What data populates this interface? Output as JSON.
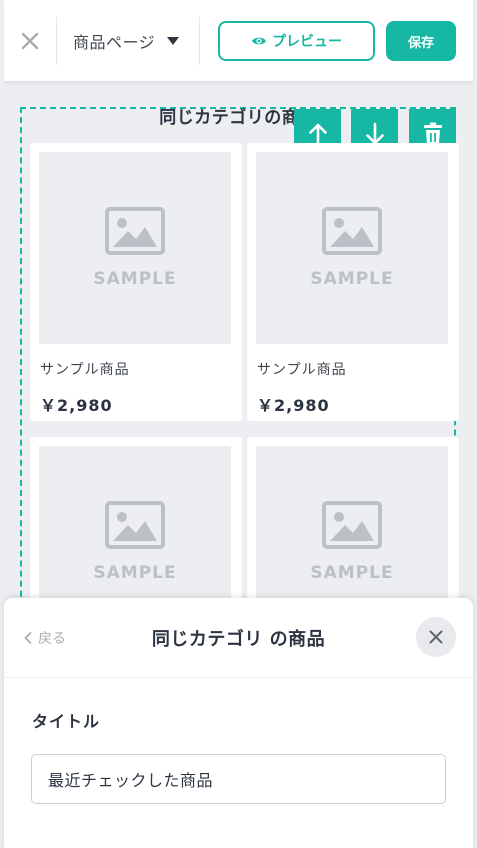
{
  "topbar": {
    "page_select_label": "商品ページ",
    "preview_label": "プレビュー",
    "save_label": "保存"
  },
  "section": {
    "title": "同じカテゴリの商品",
    "products": [
      {
        "image_text": "SAMPLE",
        "name": "サンプル商品",
        "price": "￥2,980"
      },
      {
        "image_text": "SAMPLE",
        "name": "サンプル商品",
        "price": "￥2,980"
      },
      {
        "image_text": "SAMPLE"
      },
      {
        "image_text": "SAMPLE"
      }
    ]
  },
  "sheet": {
    "back_label": "戻る",
    "title": "同じカテゴリ の商品",
    "field_label": "タイトル",
    "field_value": "最近チェックした商品"
  },
  "icons": {
    "close": "close-icon",
    "caret": "caret-down-icon",
    "eye": "eye-icon",
    "move_up": "arrow-up-icon",
    "move_down": "arrow-down-icon",
    "delete": "trash-icon",
    "image_placeholder": "image-placeholder-icon",
    "back": "chevron-left-icon"
  },
  "colors": {
    "accent": "#16b8a4",
    "background": "#eceef2",
    "text": "#2b3440",
    "placeholder_text": "#bcc1c7"
  }
}
